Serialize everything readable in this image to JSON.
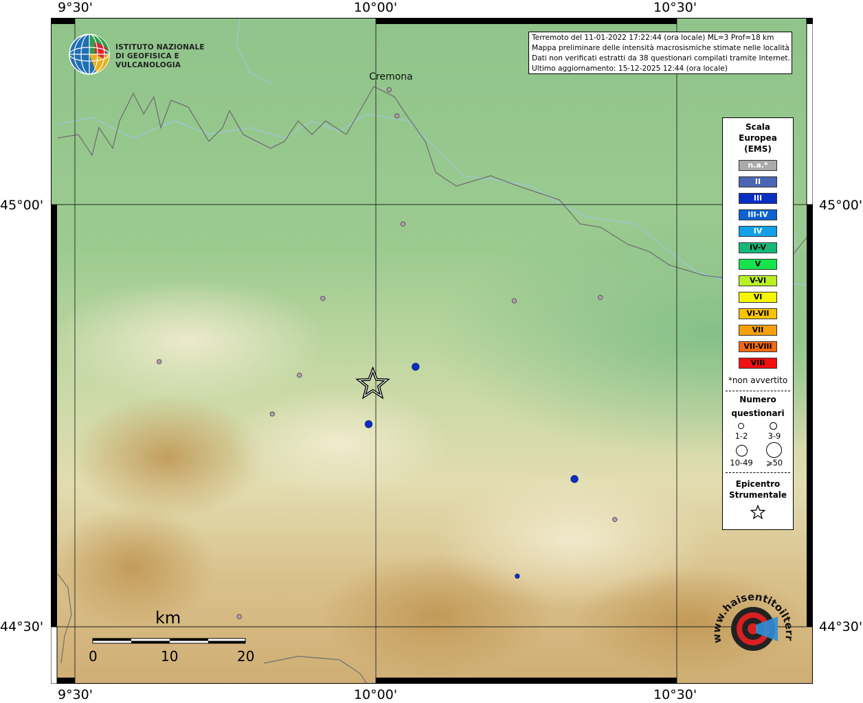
{
  "axes": {
    "lon_ticks": [
      "9°30'",
      "10°00'",
      "10°30'"
    ],
    "lat_ticks": [
      "45°00'",
      "44°30'"
    ]
  },
  "info_box": {
    "line1": "Terremoto del 11-01-2022 17:22:44 (ora locale) ML=3 Prof=18 km",
    "line2": "Mappa preliminare delle intensità macrosismiche stimate nelle località",
    "line3": "Dati non verificati estratti da 38 questionari compilati tramite Internet.",
    "line4": "Ultimo aggiornamento: 15-12-2025 12:44 (ora locale)"
  },
  "ingv_logo": {
    "line1": "ISTITUTO NAZIONALE",
    "line2": "DI GEOFISICA E VULCANOLOGIA"
  },
  "places": [
    {
      "name": "Cremona",
      "lon": 10.022,
      "lat": 45.136
    }
  ],
  "observations": [
    {
      "lon": 10.022,
      "lat": 45.136,
      "intensity": "n.a.",
      "size": "1-2"
    },
    {
      "lon": 10.035,
      "lat": 45.105,
      "intensity": "n.a.",
      "size": "1-2"
    },
    {
      "lon": 10.045,
      "lat": 44.977,
      "intensity": "n.a.",
      "size": "1-2"
    },
    {
      "lon": 9.912,
      "lat": 44.889,
      "intensity": "n.a.",
      "size": "1-2"
    },
    {
      "lon": 10.23,
      "lat": 44.886,
      "intensity": "n.a.",
      "size": "1-2"
    },
    {
      "lon": 10.373,
      "lat": 44.89,
      "intensity": "n.a.",
      "size": "1-2"
    },
    {
      "lon": 9.64,
      "lat": 44.814,
      "intensity": "n.a.",
      "size": "1-2"
    },
    {
      "lon": 9.873,
      "lat": 44.798,
      "intensity": "n.a.",
      "size": "1-2"
    },
    {
      "lon": 9.828,
      "lat": 44.752,
      "intensity": "n.a.",
      "size": "1-2"
    },
    {
      "lon": 10.397,
      "lat": 44.627,
      "intensity": "n.a.",
      "size": "1-2"
    },
    {
      "lon": 9.773,
      "lat": 44.512,
      "intensity": "n.a.",
      "size": "1-2"
    },
    {
      "lon": 10.066,
      "lat": 44.808,
      "intensity": "III",
      "size": "3-9"
    },
    {
      "lon": 9.988,
      "lat": 44.74,
      "intensity": "III",
      "size": "3-9"
    },
    {
      "lon": 10.33,
      "lat": 44.675,
      "intensity": "III",
      "size": "3-9"
    },
    {
      "lon": 10.235,
      "lat": 44.56,
      "intensity": "III",
      "size": "1-2"
    }
  ],
  "epicenter": {
    "lon": 9.995,
    "lat": 44.787
  },
  "legend": {
    "title1": "Scala",
    "title2": "Europea",
    "title3": "(EMS)",
    "classes": [
      {
        "label": "n.a.*",
        "color": "#aaaaaa",
        "text": "#ffffff"
      },
      {
        "label": "II",
        "color": "#4a66b4",
        "text": "#ffffff"
      },
      {
        "label": "III",
        "color": "#0a2ec2",
        "text": "#ffffff"
      },
      {
        "label": "III-IV",
        "color": "#0d62d0",
        "text": "#ffffff"
      },
      {
        "label": "IV",
        "color": "#12a1e6",
        "text": "#ffffff"
      },
      {
        "label": "IV-V",
        "color": "#16b87a",
        "text": "#000000"
      },
      {
        "label": "V",
        "color": "#16e44c",
        "text": "#000000"
      },
      {
        "label": "V-VI",
        "color": "#b8f024",
        "text": "#000000"
      },
      {
        "label": "VI",
        "color": "#f6f600",
        "text": "#000000"
      },
      {
        "label": "VI-VII",
        "color": "#f7c400",
        "text": "#000000"
      },
      {
        "label": "VII",
        "color": "#f7a10a",
        "text": "#000000"
      },
      {
        "label": "VII-VIII",
        "color": "#f26a10",
        "text": "#000000"
      },
      {
        "label": "VIII",
        "color": "#f01010",
        "text": "#000000"
      }
    ],
    "not_felt_note": "*non avvertito",
    "count_title1": "Numero",
    "count_title2": "questionari",
    "count_sizes": [
      "1-2",
      "3-9",
      "10-49",
      "⩾50"
    ],
    "epicenter_title1": "Epicentro",
    "epicenter_title2": "Strumentale"
  },
  "scale_bar": {
    "unit": "km",
    "labels": [
      "0",
      "10",
      "20"
    ]
  },
  "hsentito_logo": {
    "text": "www.haisentitoilterremoto.it"
  }
}
